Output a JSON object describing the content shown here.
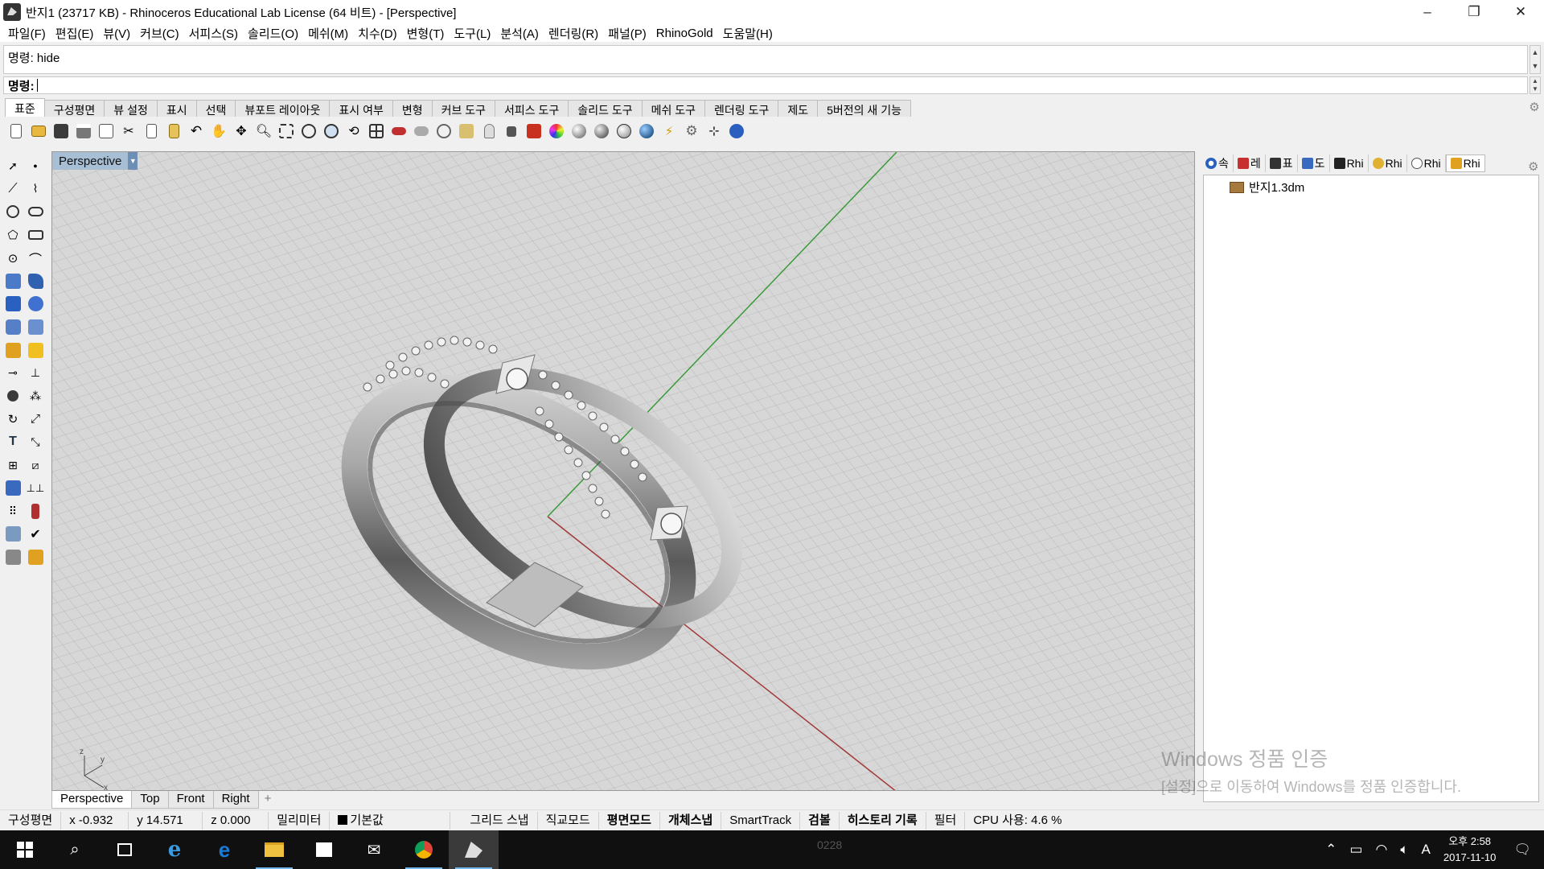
{
  "window": {
    "title": "반지1 (23717 KB) - Rhinoceros Educational Lab License (64 비트) - [Perspective]",
    "controls": {
      "minimize": "–",
      "maximize": "❐",
      "close": "✕"
    }
  },
  "menu": [
    "파일(F)",
    "편집(E)",
    "뷰(V)",
    "커브(C)",
    "서피스(S)",
    "솔리드(O)",
    "메쉬(M)",
    "치수(D)",
    "변형(T)",
    "도구(L)",
    "분석(A)",
    "렌더링(R)",
    "패널(P)",
    "RhinoGold",
    "도움말(H)"
  ],
  "command": {
    "history": "명령: hide",
    "prompt": "명령:",
    "value": ""
  },
  "toolbar_tabs": [
    "표준",
    "구성평면",
    "뷰 설정",
    "표시",
    "선택",
    "뷰포트 레이아웃",
    "표시 여부",
    "변형",
    "커브 도구",
    "서피스 도구",
    "솔리드 도구",
    "메쉬 도구",
    "렌더링 도구",
    "제도",
    "5버전의 새 기능"
  ],
  "viewport": {
    "label": "Perspective",
    "axis_labels": {
      "x": "x",
      "y": "y",
      "z": "z"
    }
  },
  "viewport_tabs": [
    "Perspective",
    "Top",
    "Front",
    "Right"
  ],
  "viewport_tab_add": "+",
  "panel": {
    "tabs": [
      "속",
      "레",
      "표",
      "도",
      "Rhi",
      "Rhi",
      "Rhi",
      "Rhi"
    ],
    "file": "반지1.3dm"
  },
  "watermark": {
    "line1": "Windows 정품 인증",
    "line2": "[설정]으로 이동하여 Windows를 정품 인증합니다."
  },
  "status": {
    "cplane": "구성평면",
    "x": "x -0.932",
    "y": "y 14.571",
    "z": "z 0.000",
    "units": "밀리미터",
    "layer": "기본값",
    "grid_snap": "그리드 스냅",
    "ortho": "직교모드",
    "planar": "평면모드",
    "osnap": "개체스냅",
    "smarttrack": "SmartTrack",
    "gumball": "검볼",
    "history": "히스토리 기록",
    "filter": "필터",
    "cpu": "CPU 사용: 4.6 %"
  },
  "taskbar": {
    "ghost_text": "0228",
    "clock_time": "오후 2:58",
    "clock_date": "2017-11-10",
    "ime": "A"
  },
  "colors": {
    "viewport_bg": "#d7d7d7",
    "grid": "#bdbdbd",
    "x_axis": "#a33a3a",
    "y_axis": "#3a9a3a",
    "viewport_label_bg": "#a7bed4",
    "taskbar": "#101010"
  }
}
